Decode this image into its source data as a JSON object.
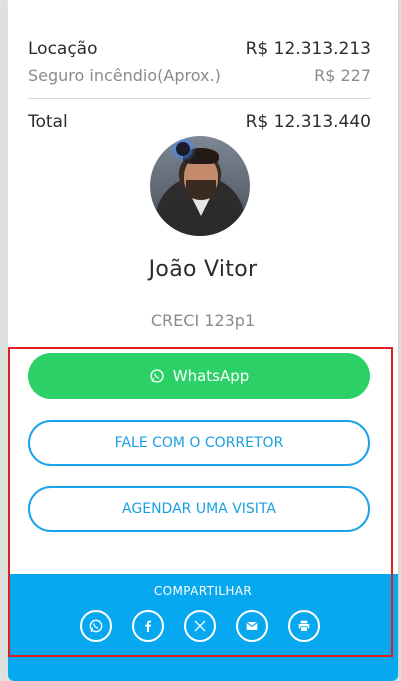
{
  "pricing": {
    "locacao_label": "Locação",
    "locacao_value": "R$ 12.313.213",
    "seguro_label": "Seguro incêndio(Aprox.)",
    "seguro_value": "R$ 227",
    "total_label": "Total",
    "total_value": "R$ 12.313.440"
  },
  "agent": {
    "name": "João Vitor",
    "creci": "CRECI 123p1"
  },
  "actions": {
    "whatsapp_label": "WhatsApp",
    "fale_label": "FALE COM O CORRETOR",
    "agendar_label": "AGENDAR UMA VISITA"
  },
  "share": {
    "title": "COMPARTILHAR",
    "icons": [
      "whatsapp-icon",
      "facebook-icon",
      "x-icon",
      "email-icon",
      "print-icon"
    ]
  },
  "colors": {
    "whatsapp_green": "#2bd167",
    "accent_blue": "#1aa3e8",
    "share_bar": "#07a8ef",
    "highlight_red": "#e0201f"
  }
}
